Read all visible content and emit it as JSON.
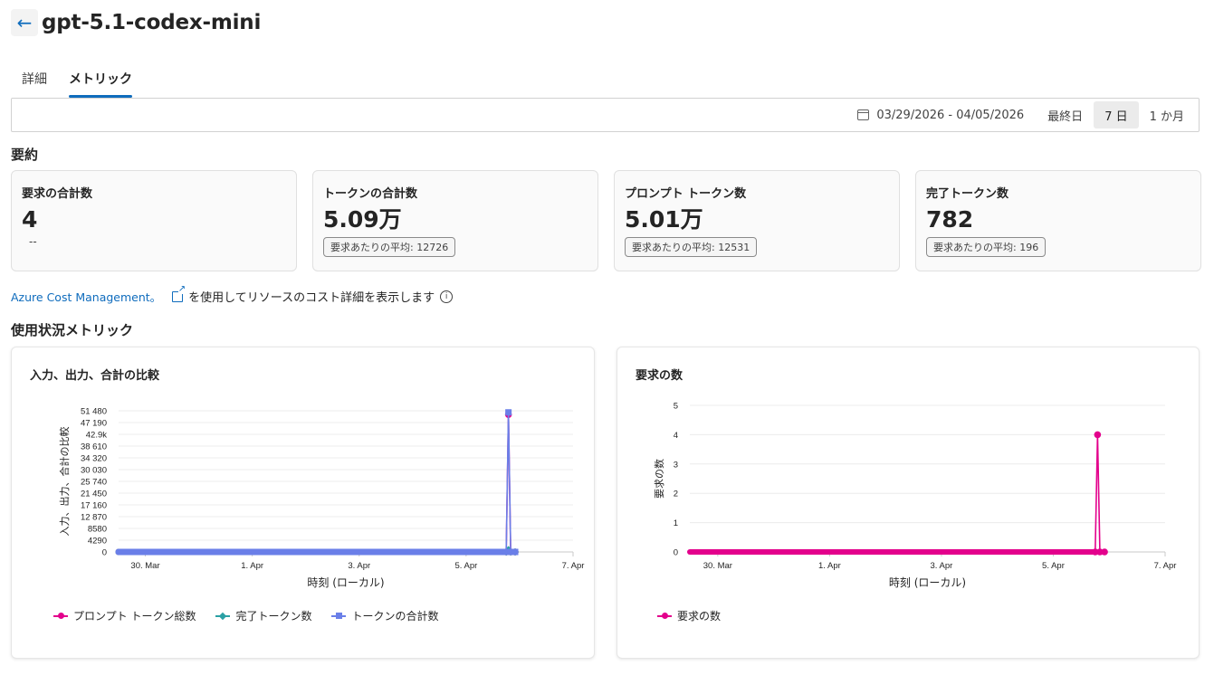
{
  "header": {
    "title": "gpt-5.1-codex-mini",
    "back_icon": "arrow-left-icon"
  },
  "tabs": [
    {
      "label": "詳細",
      "active": false
    },
    {
      "label": "メトリック",
      "active": true
    }
  ],
  "toolbar": {
    "date_range": "03/29/2026 - 04/05/2026",
    "ranges": [
      {
        "label": "最終日",
        "selected": false
      },
      {
        "label": "7 日",
        "selected": true
      },
      {
        "label": "1 か月",
        "selected": false
      }
    ]
  },
  "summary": {
    "title": "要約",
    "cards": [
      {
        "label": "要求の合計数",
        "value": "4",
        "sub": "--",
        "badge": ""
      },
      {
        "label": "トークンの合計数",
        "value": "5.09万",
        "sub": "",
        "badge": "要求あたりの平均: 12726"
      },
      {
        "label": "プロンプト トークン数",
        "value": "5.01万",
        "sub": "",
        "badge": "要求あたりの平均: 12531"
      },
      {
        "label": "完了トークン数",
        "value": "782",
        "sub": "",
        "badge": "要求あたりの平均: 196"
      }
    ]
  },
  "cost": {
    "link": "Azure Cost Management。",
    "text": "を使用してリソースのコスト詳細を表示します"
  },
  "usage": {
    "title": "使用状況メトリック"
  },
  "colors": {
    "accent": "#0f6cbd",
    "prompt": "#e3008c",
    "completion": "#2aa0a4",
    "total": "#6a7fe8",
    "requests": "#e3008c"
  },
  "chart_data": [
    {
      "type": "line",
      "title": "入力、出力、合計の比較",
      "xlabel": "時刻 (ローカル)",
      "ylabel": "入力、出力、合計の比較",
      "x_ticks": [
        "30. Mar",
        "1. Apr",
        "3. Apr",
        "5. Apr",
        "7. Apr"
      ],
      "y_ticks": [
        "0",
        "4290",
        "8580",
        "12 870",
        "17 160",
        "21 450",
        "25 740",
        "30 030",
        "34 320",
        "38 610",
        "42.9k",
        "47 190",
        "51 480"
      ],
      "ylim": [
        0,
        51480
      ],
      "xlim": [
        "2026-03-29T12:00",
        "2026-04-07T00:00"
      ],
      "series": [
        {
          "name": "プロンプト トークン総数",
          "marker": "circle",
          "points": [
            [
              "2026-03-29T12:00",
              0
            ],
            [
              "2026-04-05T18:00",
              0
            ],
            [
              "2026-04-05T19:00",
              50100
            ],
            [
              "2026-04-05T20:00",
              0
            ],
            [
              "2026-04-05T22:00",
              0
            ]
          ]
        },
        {
          "name": "完了トークン数",
          "marker": "diamond",
          "points": [
            [
              "2026-03-29T12:00",
              0
            ],
            [
              "2026-04-05T18:00",
              0
            ],
            [
              "2026-04-05T19:00",
              782
            ],
            [
              "2026-04-05T20:00",
              0
            ],
            [
              "2026-04-05T22:00",
              0
            ]
          ]
        },
        {
          "name": "トークンの合計数",
          "marker": "square",
          "points": [
            [
              "2026-03-29T12:00",
              0
            ],
            [
              "2026-04-05T18:00",
              0
            ],
            [
              "2026-04-05T19:00",
              50900
            ],
            [
              "2026-04-05T20:00",
              0
            ],
            [
              "2026-04-05T22:00",
              0
            ]
          ]
        }
      ],
      "grid": true,
      "legend": "bottom-left"
    },
    {
      "type": "line",
      "title": "要求の数",
      "xlabel": "時刻 (ローカル)",
      "ylabel": "要求の数",
      "x_ticks": [
        "30. Mar",
        "1. Apr",
        "3. Apr",
        "5. Apr",
        "7. Apr"
      ],
      "y_ticks": [
        "0",
        "1",
        "2",
        "3",
        "4",
        "5"
      ],
      "ylim": [
        0,
        5
      ],
      "xlim": [
        "2026-03-29T12:00",
        "2026-04-07T00:00"
      ],
      "series": [
        {
          "name": "要求の数",
          "marker": "circle",
          "points": [
            [
              "2026-03-29T12:00",
              0
            ],
            [
              "2026-04-05T18:00",
              0
            ],
            [
              "2026-04-05T19:00",
              4
            ],
            [
              "2026-04-05T20:00",
              0
            ],
            [
              "2026-04-05T22:00",
              0
            ]
          ]
        }
      ],
      "grid": true,
      "legend": "bottom-left"
    }
  ]
}
